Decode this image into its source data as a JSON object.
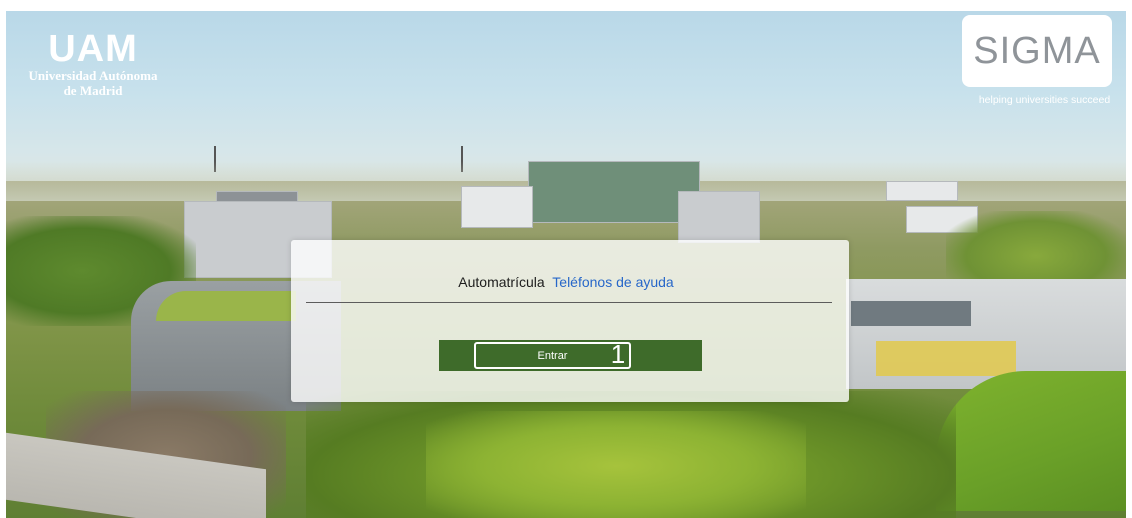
{
  "logo_left": {
    "mark": "UAM",
    "line1": "Universidad Autónoma",
    "line2": "de Madrid"
  },
  "logo_right": {
    "name": "SIGMA",
    "tagline": "helping universities succeed"
  },
  "panel": {
    "label": "Automatrícula",
    "help_link": "Teléfonos de ayuda",
    "enter_button": "Entrar",
    "step_marker": "1"
  },
  "colors": {
    "button_green": "#3e6b2a",
    "link_blue": "#2767c9"
  }
}
